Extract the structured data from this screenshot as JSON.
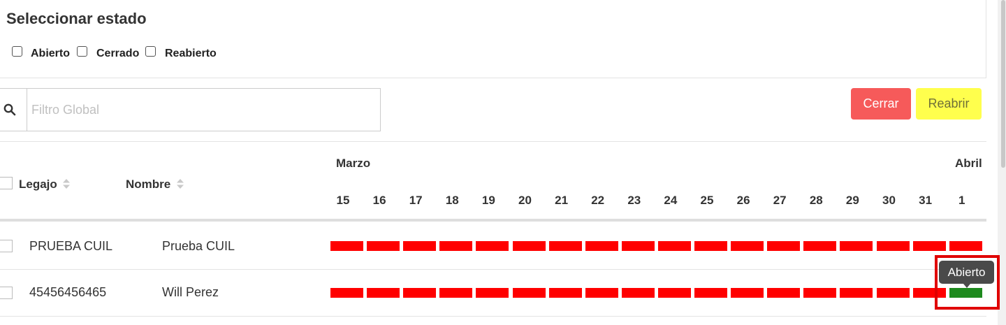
{
  "status_panel": {
    "title": "Seleccionar estado",
    "options": [
      {
        "label": "Abierto",
        "checked": false
      },
      {
        "label": "Cerrado",
        "checked": false
      },
      {
        "label": "Reabierto",
        "checked": false
      }
    ]
  },
  "filter": {
    "placeholder": "Filtro Global",
    "value": "",
    "icon": "search-icon"
  },
  "actions": {
    "close_label": "Cerrar",
    "reopen_label": "Reabrir",
    "close_color": "#f65a5a",
    "reopen_color": "#ffff4d"
  },
  "table": {
    "columns": {
      "legajo": "Legajo",
      "nombre": "Nombre"
    },
    "months": [
      {
        "label": "Marzo"
      },
      {
        "label": "Abril"
      }
    ],
    "days": [
      "15",
      "16",
      "17",
      "18",
      "19",
      "20",
      "21",
      "22",
      "23",
      "24",
      "25",
      "26",
      "27",
      "28",
      "29",
      "30",
      "31",
      "1"
    ],
    "rows": [
      {
        "legajo": "PRUEBA CUIL",
        "nombre": "Prueba CUIL",
        "status": [
          "closed",
          "closed",
          "closed",
          "closed",
          "closed",
          "closed",
          "closed",
          "closed",
          "closed",
          "closed",
          "closed",
          "closed",
          "closed",
          "closed",
          "closed",
          "closed",
          "closed",
          "closed"
        ]
      },
      {
        "legajo": "45456456465",
        "nombre": "Will Perez",
        "status": [
          "closed",
          "closed",
          "closed",
          "closed",
          "closed",
          "closed",
          "closed",
          "closed",
          "closed",
          "closed",
          "closed",
          "closed",
          "closed",
          "closed",
          "closed",
          "closed",
          "closed",
          "open"
        ]
      }
    ],
    "status_colors": {
      "closed": "#ff0000",
      "open": "#1e8a1e"
    }
  },
  "tooltip": {
    "text": "Abierto"
  }
}
